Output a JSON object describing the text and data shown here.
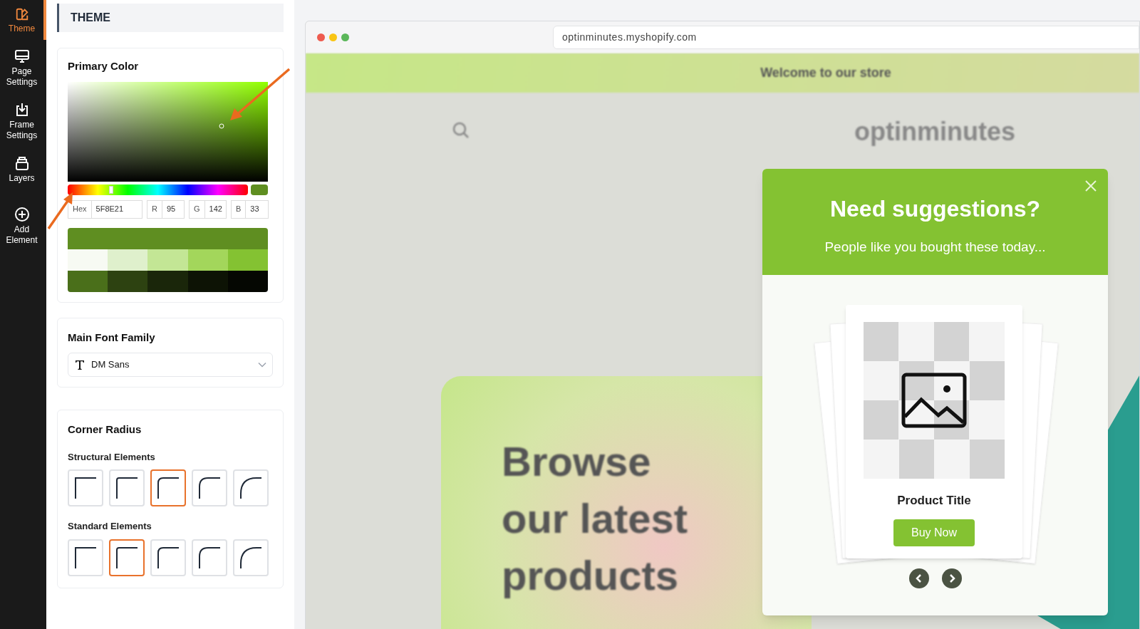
{
  "nav": [
    {
      "label": "Theme",
      "selected": true
    },
    {
      "label": "Page Settings",
      "selected": false
    },
    {
      "label": "Frame Settings",
      "selected": false
    },
    {
      "label": "Layers",
      "selected": false
    },
    {
      "label": "Add Element",
      "selected": false
    }
  ],
  "panel_title": "THEME",
  "primary_color": {
    "title": "Primary Color",
    "hue_slider": {
      "level": 0.24
    },
    "fields": [
      {
        "label": "Hex",
        "value": "5F8E21"
      },
      {
        "label": "R",
        "value": "95"
      },
      {
        "label": "G",
        "value": "142"
      },
      {
        "label": "B",
        "value": "33"
      }
    ],
    "palette": [
      [
        {
          "color": "#5f8e21"
        }
      ],
      [
        {
          "color": "#f7faf3"
        },
        {
          "color": "#dff0cc"
        },
        {
          "color": "#c3e695"
        },
        {
          "color": "#a3d65b"
        },
        {
          "color": "#84c232"
        }
      ],
      [
        {
          "color": "#4a6f1a"
        },
        {
          "color": "#2d4211"
        },
        {
          "color": "#1a260a"
        },
        {
          "color": "#0d1305"
        },
        {
          "color": "#050702"
        }
      ]
    ]
  },
  "font": {
    "title": "Main Font Family",
    "value": "DM Sans"
  },
  "corner_radius": {
    "title": "Corner Radius",
    "groups": [
      {
        "label": "Structural Elements",
        "options": [
          {
            "selected": false
          },
          {
            "selected": false
          },
          {
            "selected": true
          },
          {
            "selected": false
          },
          {
            "selected": false
          }
        ]
      },
      {
        "label": "Standard Elements",
        "options": [
          {
            "selected": false
          },
          {
            "selected": true
          },
          {
            "selected": false
          },
          {
            "selected": false
          },
          {
            "selected": false
          }
        ]
      }
    ]
  },
  "preview": {
    "url": "optinminutes.myshopify.com",
    "banner": "Welcome to our store",
    "logo": "optinminutes",
    "hero": "Browse our latest products",
    "popup": {
      "title": "Need suggestions?",
      "subtitle": "People like you bought these today...",
      "product_title": "Product Title",
      "button": "Buy Now"
    }
  }
}
